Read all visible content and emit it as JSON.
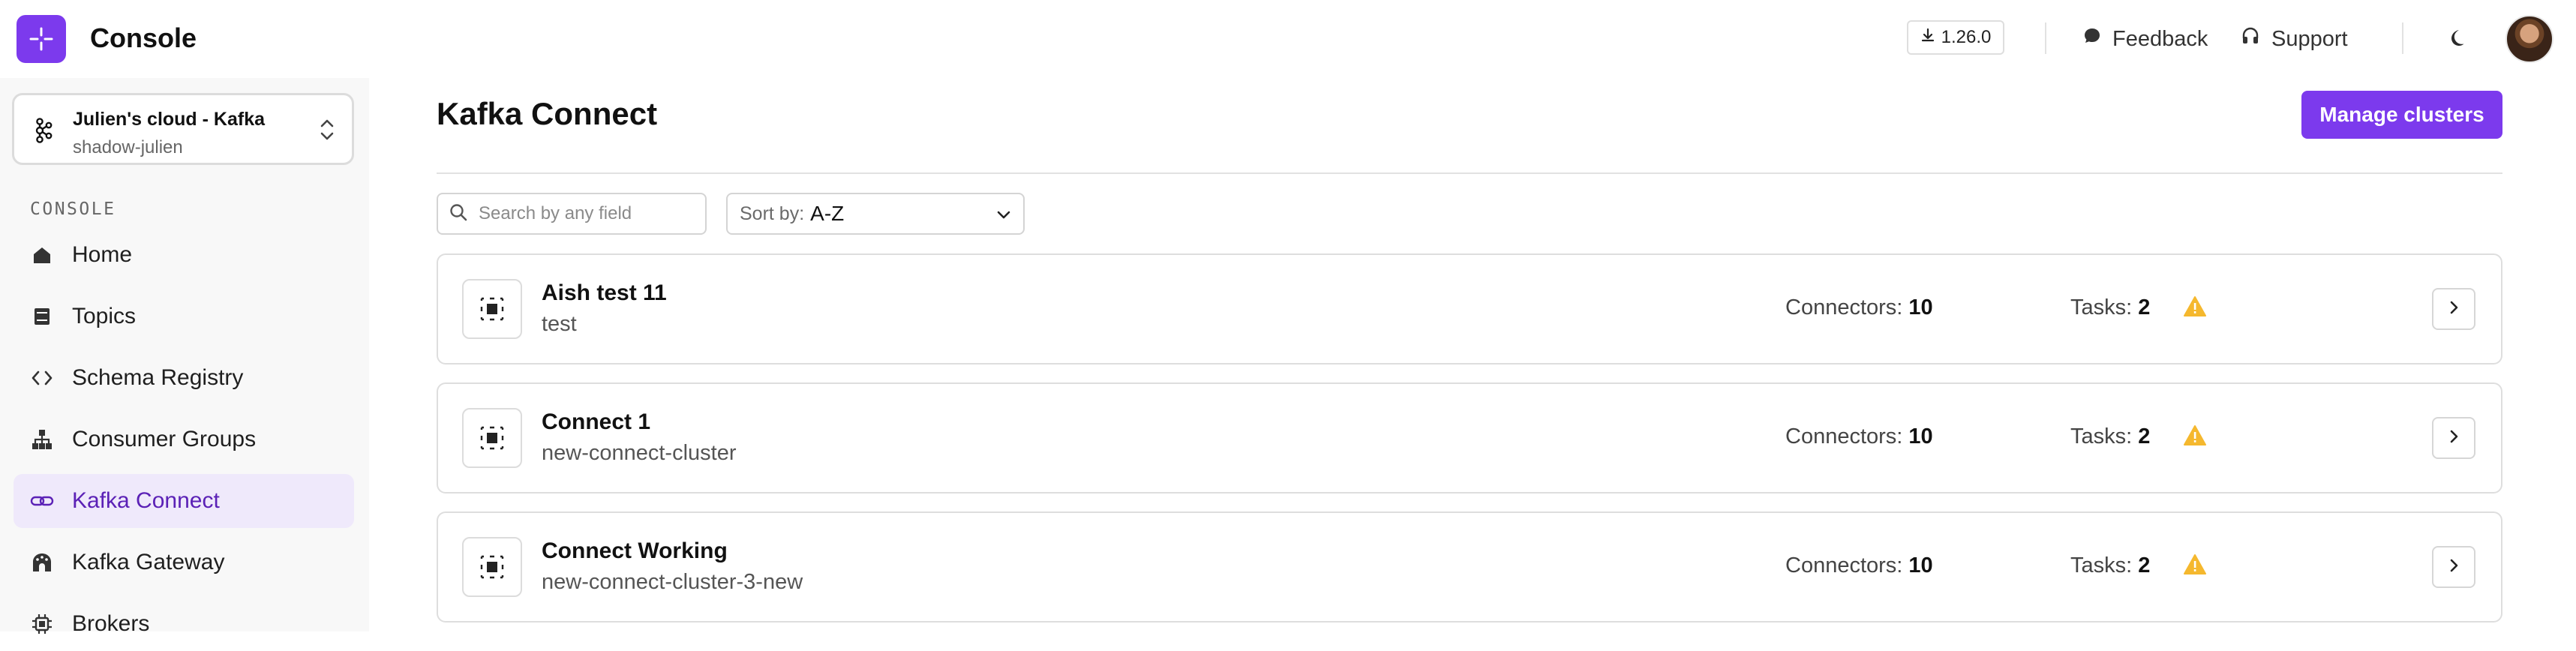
{
  "app": {
    "title": "Console",
    "version": "1.26.0"
  },
  "topbar": {
    "feedback_label": "Feedback",
    "support_label": "Support",
    "accent_color": "#7c3aed"
  },
  "cluster": {
    "name": "Julien's cloud - Kafka",
    "subtitle": "shadow-julien"
  },
  "sidebar": {
    "section_label": "CONSOLE",
    "items": [
      {
        "label": "Home",
        "icon": "home-icon",
        "active": false
      },
      {
        "label": "Topics",
        "icon": "topics-icon",
        "active": false
      },
      {
        "label": "Schema Registry",
        "icon": "code-icon",
        "active": false
      },
      {
        "label": "Consumer Groups",
        "icon": "hierarchy-icon",
        "active": false
      },
      {
        "label": "Kafka Connect",
        "icon": "link-icon",
        "active": true
      },
      {
        "label": "Kafka Gateway",
        "icon": "gateway-icon",
        "active": false
      },
      {
        "label": "Brokers",
        "icon": "chip-icon",
        "active": false
      }
    ]
  },
  "main": {
    "title": "Kafka Connect",
    "manage_button": "Manage clusters",
    "search": {
      "placeholder": "Search by any field",
      "value": ""
    },
    "sort": {
      "label": "Sort by:",
      "value": "A-Z"
    },
    "connectors_label": "Connectors:",
    "tasks_label": "Tasks:",
    "clusters": [
      {
        "name": "Aish test 11",
        "subtitle": "test",
        "connectors": "10",
        "tasks": "2",
        "status": "warning"
      },
      {
        "name": "Connect 1",
        "subtitle": "new-connect-cluster",
        "connectors": "10",
        "tasks": "2",
        "status": "warning"
      },
      {
        "name": "Connect Working",
        "subtitle": "new-connect-cluster-3-new",
        "connectors": "10",
        "tasks": "2",
        "status": "warning"
      }
    ]
  }
}
